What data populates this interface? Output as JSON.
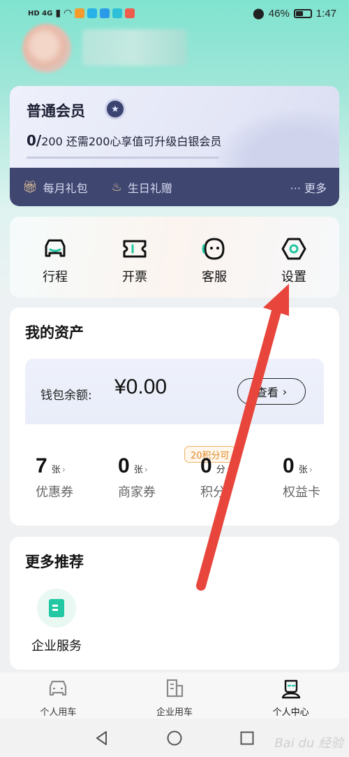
{
  "status_bar": {
    "left_text": "HD 4G",
    "battery_percent": "46%",
    "time": "1:47"
  },
  "member": {
    "title": "普通会员",
    "progress_current": "0/",
    "progress_detail": "200 还需200心享值可升级白银会员",
    "progress_fraction": 0.0,
    "perk1": "每月礼包",
    "perk2": "生日礼赠",
    "more": "··· 更多"
  },
  "quick_actions": [
    {
      "label": "行程",
      "icon": "car-icon"
    },
    {
      "label": "开票",
      "icon": "ticket-icon"
    },
    {
      "label": "客服",
      "icon": "service-icon"
    },
    {
      "label": "设置",
      "icon": "settings-icon"
    }
  ],
  "assets": {
    "title": "我的资产",
    "wallet_label": "钱包余额:",
    "wallet_value": "¥0.00",
    "view_button": "查看",
    "points_tag": "20积分可",
    "items": [
      {
        "count": "7",
        "unit": "张",
        "label": "优惠券"
      },
      {
        "count": "0",
        "unit": "张",
        "label": "商家券"
      },
      {
        "count": "0",
        "unit": "分",
        "label": "积分"
      },
      {
        "count": "0",
        "unit": "张",
        "label": "权益卡"
      }
    ]
  },
  "recommend": {
    "title": "更多推荐",
    "item_label": "企业服务"
  },
  "bottom_nav": [
    {
      "label": "个人用车",
      "icon": "car-outline-icon"
    },
    {
      "label": "企业用车",
      "icon": "building-icon"
    },
    {
      "label": "个人中心",
      "icon": "person-icon"
    }
  ],
  "watermark": "Bai du 经验",
  "colors": {
    "accent": "#22c7a3",
    "member_dark": "#3f4670",
    "points_tag": "#e28a2b",
    "arrow": "#e8453c"
  }
}
